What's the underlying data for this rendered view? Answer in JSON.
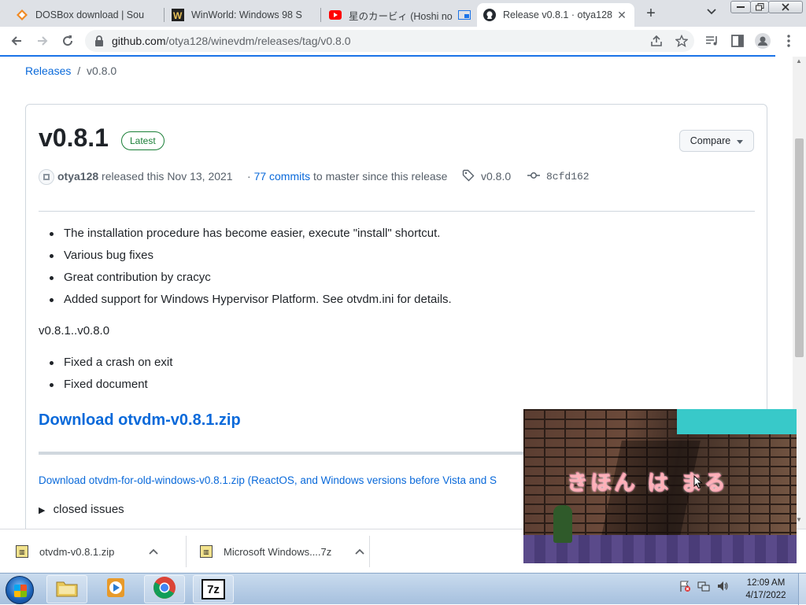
{
  "browser": {
    "tabs": [
      {
        "title": "DOSBox download | Sou",
        "icon": "dosbox-icon",
        "active": false
      },
      {
        "title": "WinWorld: Windows 98 S",
        "icon": "winworld-icon",
        "active": false
      },
      {
        "title": "星のカービィ (Hoshi no",
        "icon": "youtube-icon",
        "active": false
      },
      {
        "title": "Release v0.8.1 · otya128/",
        "icon": "github-icon",
        "active": true
      }
    ],
    "new_tab": "+",
    "url_domain": "github.com",
    "url_path": "/otya128/winevdm/releases/tag/v0.8.0"
  },
  "breadcrumb": {
    "link": "Releases",
    "separator": "/",
    "current": "v0.8.0"
  },
  "release": {
    "version": "v0.8.1",
    "badge": "Latest",
    "compare_label": "Compare",
    "author": "otya128",
    "released_text": "released this Nov 13, 2021",
    "commits_prefix": "·",
    "commits_link": "77 commits",
    "commits_suffix": "to master since this release",
    "tag": "v0.8.0",
    "commit_hash": "8cfd162",
    "notes": [
      "The installation procedure has become easier, execute \"install\" shortcut.",
      "Various bug fixes",
      "Great contribution by cracyc",
      "Added support for Windows Hypervisor Platform. See otvdm.ini for details."
    ],
    "subheading": "v0.8.1..v0.8.0",
    "sub_notes": [
      "Fixed a crash on exit",
      "Fixed document"
    ],
    "download_main": "Download otvdm-v0.8.1.zip",
    "download_old": "Download otvdm-for-old-windows-v0.8.1.zip (ReactOS, and Windows versions before Vista and S",
    "closed_issues": "closed issues"
  },
  "downloads_shelf": [
    {
      "name": "otvdm-v0.8.1.zip",
      "icon": "zip-file-icon"
    },
    {
      "name": "Microsoft Windows....7z",
      "icon": "7z-file-icon"
    }
  ],
  "video_overlay": {
    "caption": "きほん は まる"
  },
  "taskbar": {
    "apps": [
      "file-explorer",
      "media-player",
      "chrome",
      "7-zip"
    ],
    "sevenzip_label": "7z",
    "time": "12:09 AM",
    "date": "4/17/2022"
  }
}
